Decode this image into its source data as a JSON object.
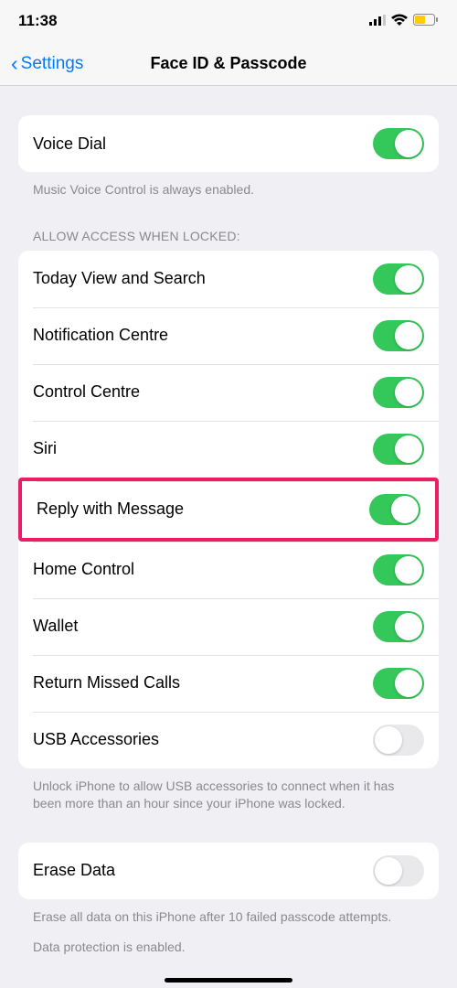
{
  "status": {
    "time": "11:38"
  },
  "nav": {
    "back": "Settings",
    "title": "Face ID & Passcode"
  },
  "voice_dial": {
    "label": "Voice Dial",
    "footer": "Music Voice Control is always enabled."
  },
  "allow_access": {
    "header": "Allow Access When Locked:",
    "items": {
      "today": "Today View and Search",
      "notif": "Notification Centre",
      "control": "Control Centre",
      "siri": "Siri",
      "reply": "Reply with Message",
      "home": "Home Control",
      "wallet": "Wallet",
      "missed": "Return Missed Calls",
      "usb": "USB Accessories"
    },
    "footer": "Unlock iPhone to allow USB accessories to connect when it has been more than an hour since your iPhone was locked."
  },
  "erase": {
    "label": "Erase Data",
    "footer1": "Erase all data on this iPhone after 10 failed passcode attempts.",
    "footer2": "Data protection is enabled."
  }
}
